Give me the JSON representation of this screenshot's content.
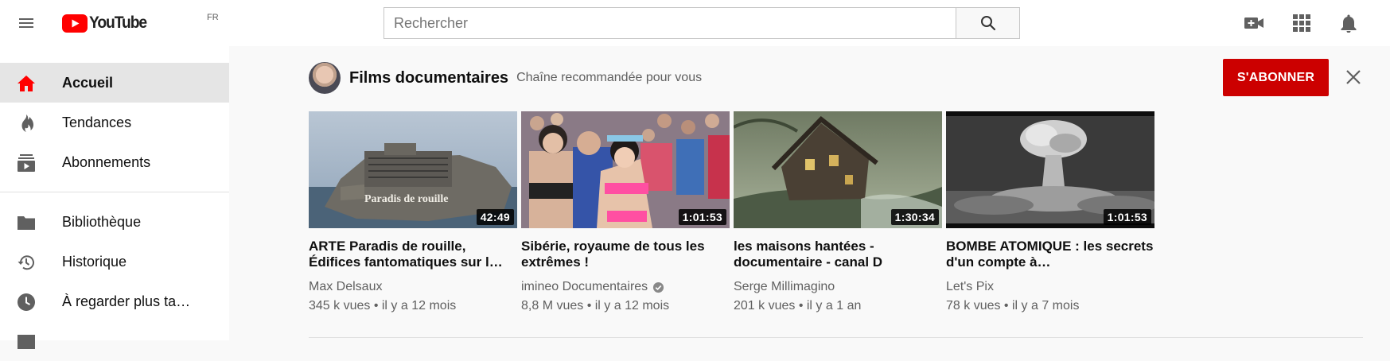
{
  "masthead": {
    "logo_text": "YouTube",
    "region": "FR",
    "search_placeholder": "Rechercher"
  },
  "sidebar": {
    "items": [
      {
        "label": "Accueil",
        "icon": "home-icon",
        "active": true
      },
      {
        "label": "Tendances",
        "icon": "flame-icon"
      },
      {
        "label": "Abonnements",
        "icon": "subscriptions-icon"
      },
      {
        "label": "Bibliothèque",
        "icon": "folder-icon"
      },
      {
        "label": "Historique",
        "icon": "history-icon"
      },
      {
        "label": "À regarder plus ta…",
        "icon": "clock-icon"
      }
    ]
  },
  "shelf": {
    "channel_name": "Films documentaires",
    "subtitle": "Chaîne recommandée pour vous",
    "subscribe_label": "S'ABONNER",
    "videos": [
      {
        "title": "ARTE Paradis de rouille, Édifices fantomatiques sur l…",
        "thumb_text": "Paradis de rouille",
        "duration": "42:49",
        "channel": "Max Delsaux",
        "verified": false,
        "meta": "345 k vues • il y a 12 mois"
      },
      {
        "title": "Sibérie, royaume de tous les extrêmes !",
        "duration": "1:01:53",
        "channel": "imineo Documentaires",
        "verified": true,
        "meta": "8,8 M vues • il y a 12 mois"
      },
      {
        "title": "les maisons hantées - documentaire - canal D",
        "duration": "1:30:34",
        "channel": "Serge Millimagino",
        "verified": false,
        "meta": "201 k vues • il y a 1 an"
      },
      {
        "title": "BOMBE ATOMIQUE : les secrets d'un compte à…",
        "duration": "1:01:53",
        "channel": "Let's Pix",
        "verified": false,
        "meta": "78 k vues • il y a 7 mois"
      }
    ]
  },
  "colors": {
    "brand_red": "#cc0000",
    "sidebar_active": "#e5e5e5",
    "secondary_text": "#606060"
  }
}
